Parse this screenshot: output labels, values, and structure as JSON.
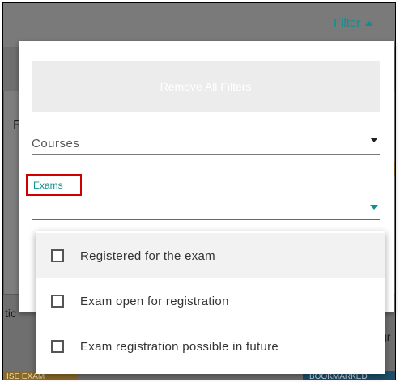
{
  "header": {
    "filter_label": "Filter"
  },
  "background": {
    "left_letter": "P",
    "left_fragment": "tic",
    "right_fragment": "gr",
    "bottom_left_fragment": "ISE EXAM",
    "bottom_right_fragment": "BOOKMARKED"
  },
  "filter_panel": {
    "remove_all_label": "Remove All Filters",
    "courses_label": "Courses",
    "exams_label": "Exams"
  },
  "exams_menu": {
    "options": [
      {
        "label": "Registered for the exam",
        "checked": false
      },
      {
        "label": "Exam open for registration",
        "checked": false
      },
      {
        "label": "Exam registration possible in future",
        "checked": false
      }
    ]
  },
  "colors": {
    "accent": "#0f8f8f",
    "highlight_box": "#d00000"
  }
}
